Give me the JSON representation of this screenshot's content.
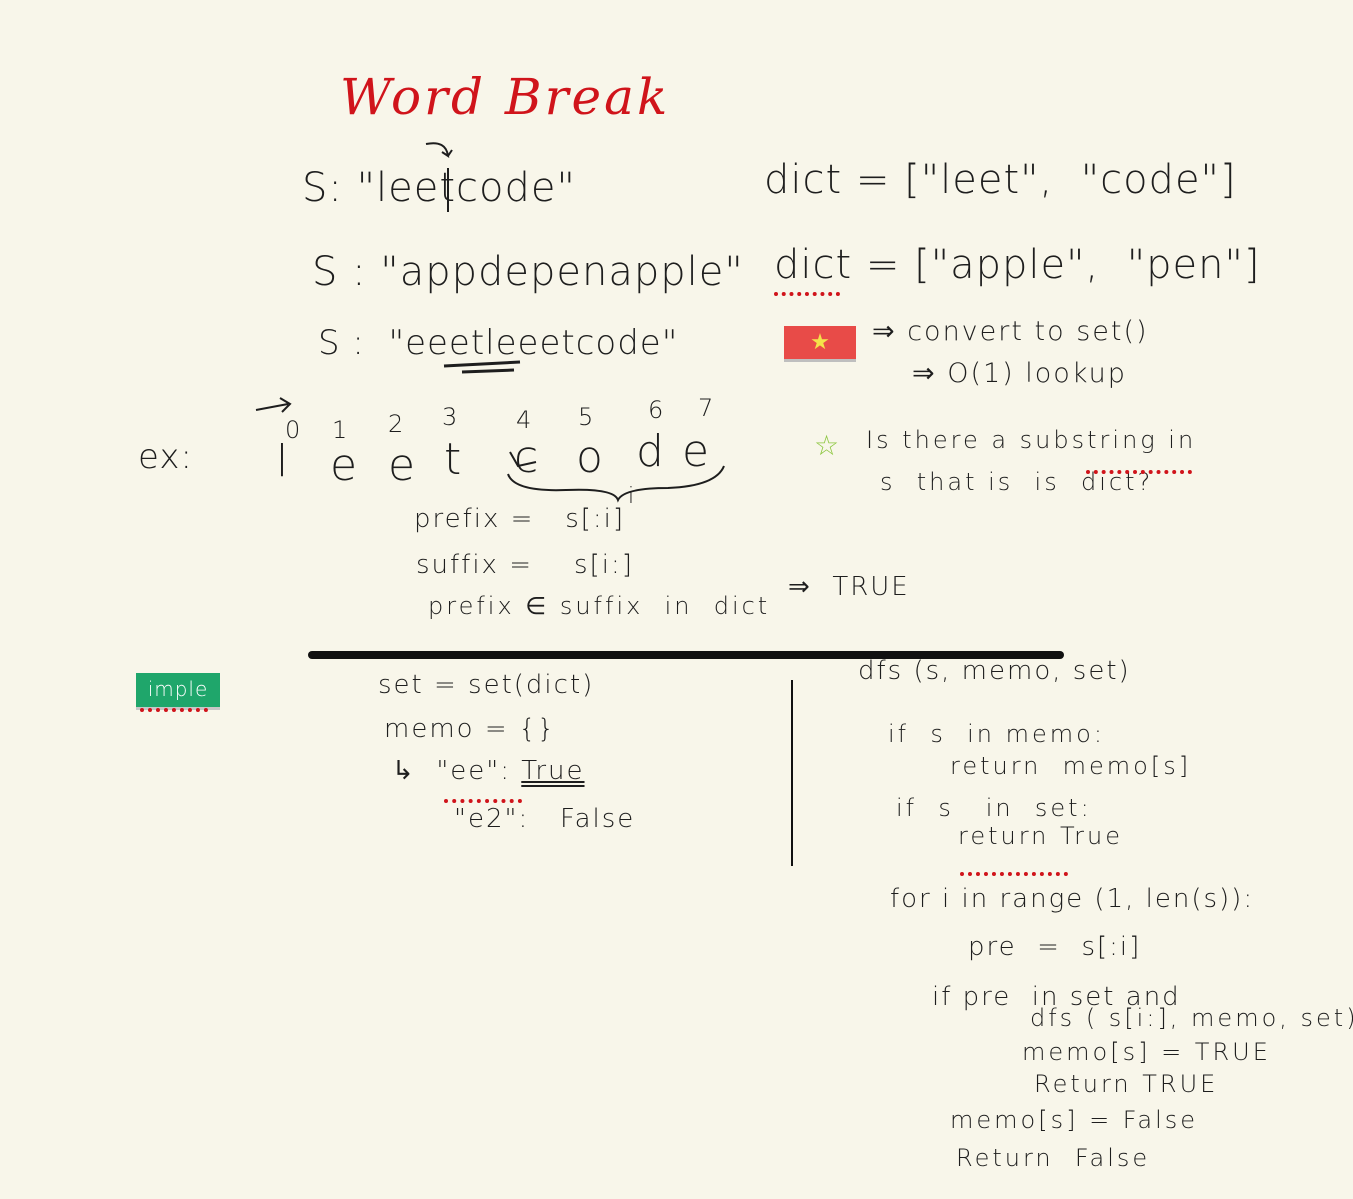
{
  "title": "Word Break",
  "examples": {
    "s1": "S: \"leetcode\"",
    "dict1": "dict = [\"leet\",  \"code\"]",
    "s2": "S : \"appdepenapple\"",
    "dict2_word": "dict",
    "dict2_rest": " = [\"apple\",  \"pen\"]",
    "s3": "S :  \"eeetleeetcode\"",
    "convert_line1": "⇒ convert to set()",
    "convert_line2": "⇒ O(1) lookup",
    "question_line1": "Is there a substring in",
    "question_line2": "s  that is  is  dict?"
  },
  "breakdown": {
    "ex_label": "ex:",
    "indices": [
      "0",
      "1",
      "2",
      "3",
      "4",
      "5",
      "6",
      "7"
    ],
    "letters": [
      "l",
      "e",
      "e",
      "t",
      "c",
      "o",
      "d",
      "e"
    ],
    "split_marker": "i",
    "prefix": "prefix =   s[:i]",
    "suffix": "suffix =    s[i:]",
    "rule_left": "prefix ∈ suffix  in  dict",
    "rule_right": "⇒  TRUE"
  },
  "impl": {
    "tag": "imple",
    "set_line": "set = set(dict)",
    "memo_line": "memo = {}",
    "arrow": "↳",
    "ee_key": "\"ee\"",
    "ee_sep": ":",
    "ee_val": "True",
    "e2_line": "\"e2\":   False"
  },
  "dfs": {
    "sig": "dfs (s, memo, set)",
    "if1": "if  s  in memo:",
    "ret1": "return  memo[s]",
    "if2": "if  s   in  set:",
    "ret2_word": "return",
    "ret2_rest": " True",
    "for": "for i in range (1, len(s)):",
    "pre": "pre  =  s[:i]",
    "if3": "if pre  in set and",
    "call": "dfs ( s[i:], memo, set)",
    "memo_true": "memo[s] = TRUE",
    "ret_true": "Return TRUE",
    "memo_false": "memo[s] = False",
    "ret_false": "Return  False"
  },
  "colors": {
    "title": "#d0141b",
    "red_tag": "#e84b48",
    "green_tag": "#1fa66b",
    "star_green": "#8cc63f",
    "dots": "#d0141b",
    "background": "#f8f6ea"
  },
  "icons": {
    "red_tag": "star-icon",
    "green_star": "star-outline-icon"
  }
}
